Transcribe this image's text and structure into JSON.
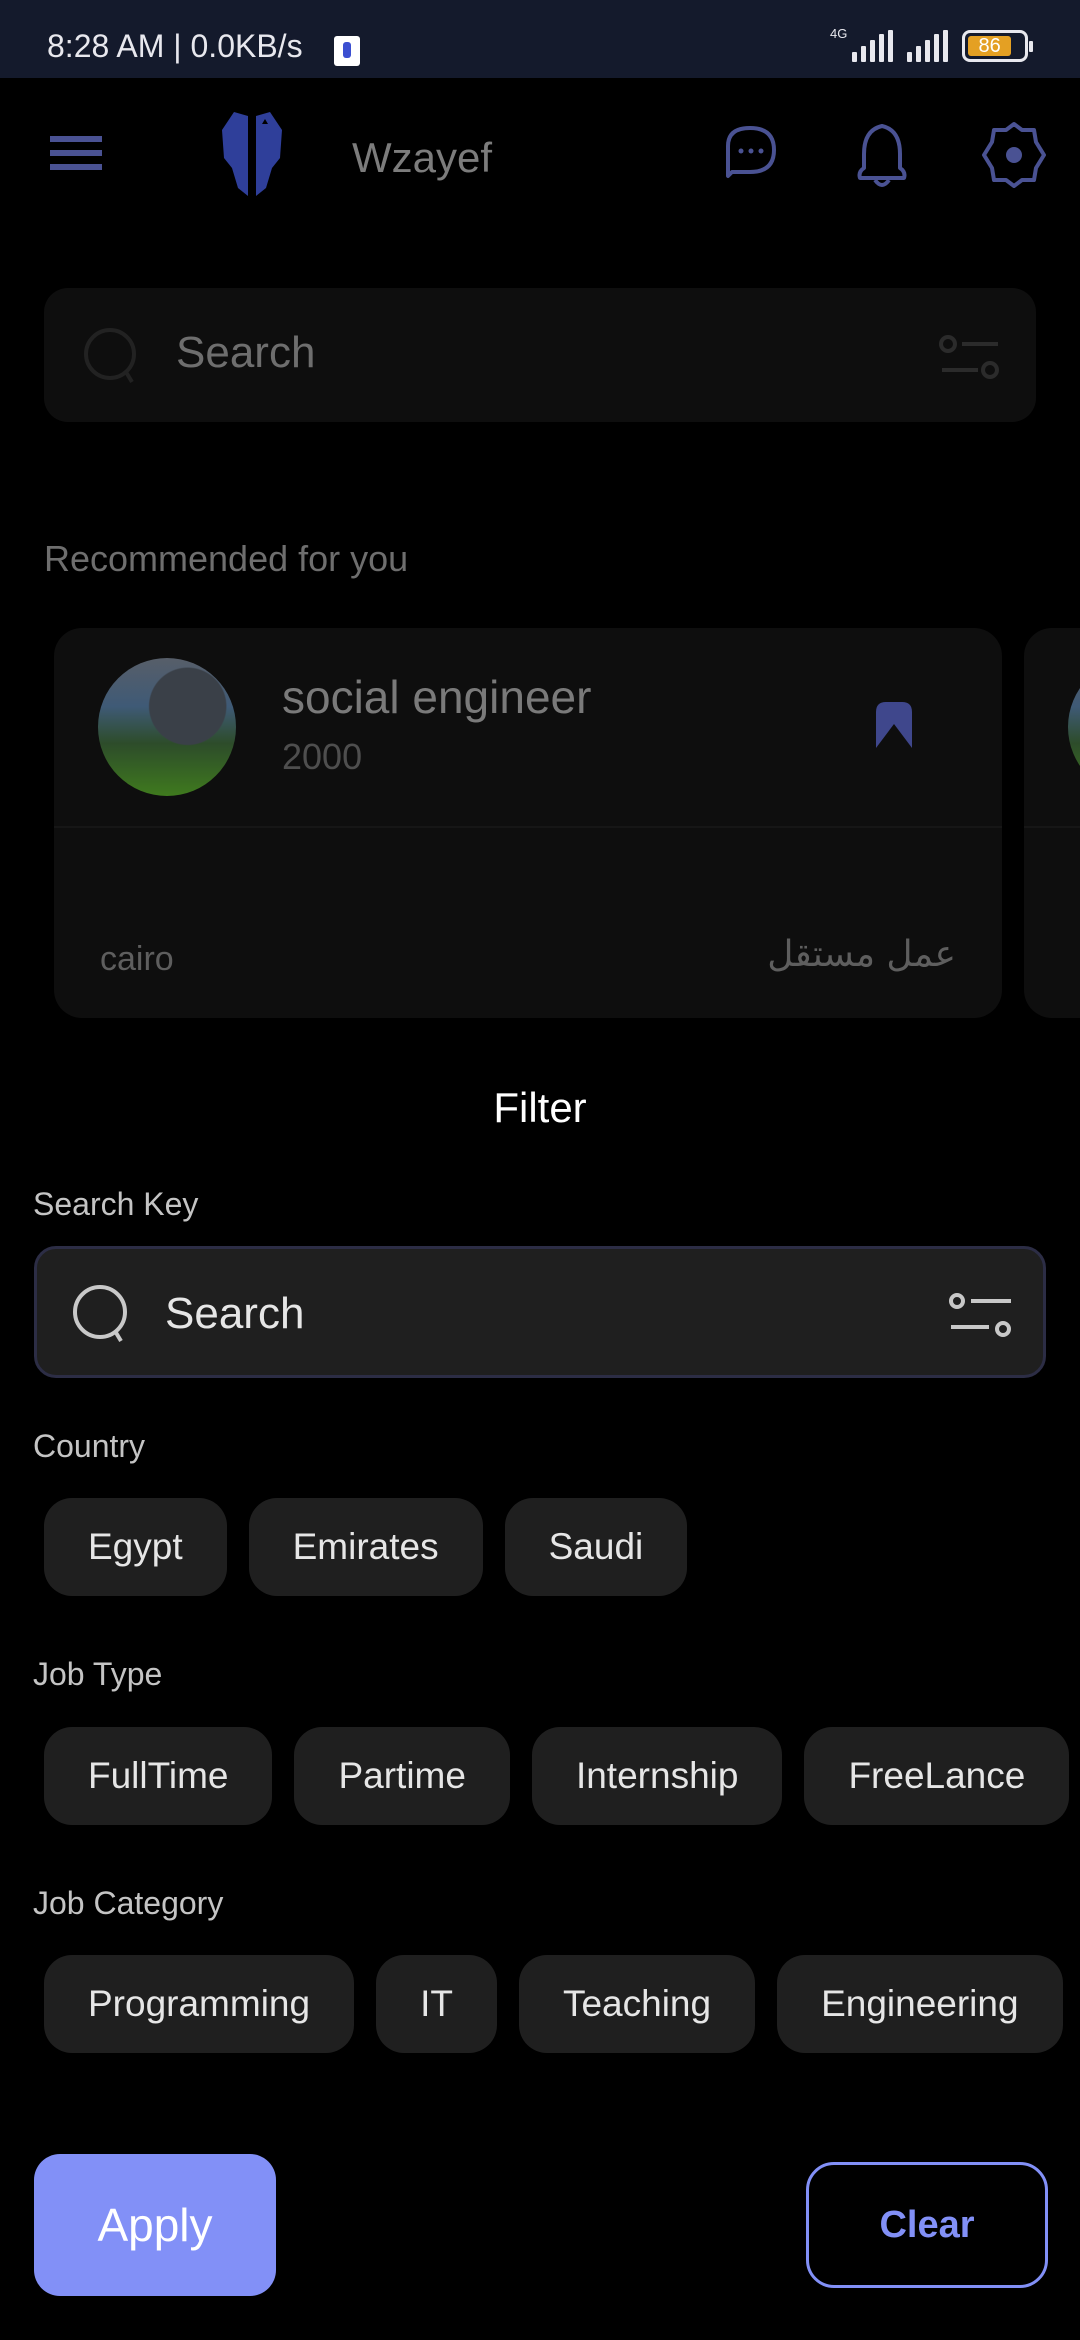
{
  "status_bar": {
    "time": "8:28 AM | 0.0KB/s",
    "network_label": "4G",
    "battery": "86"
  },
  "app_bar": {
    "title": "Wzayef",
    "icons": [
      "menu-icon",
      "logo-suit-icon",
      "chat-icon",
      "bell-icon",
      "gear-icon"
    ]
  },
  "background_search": {
    "placeholder": "Search"
  },
  "recommended": {
    "title": "Recommended for you",
    "cards": [
      {
        "title": "social engineer",
        "salary": "2000",
        "city": "cairo",
        "job_type": "عمل مستقل",
        "bookmarked": true
      }
    ]
  },
  "filter": {
    "title": "Filter",
    "search_key": {
      "label": "Search Key",
      "placeholder": "Search",
      "value": ""
    },
    "country": {
      "label": "Country",
      "options": [
        "Egypt",
        "Emirates",
        "Saudi"
      ]
    },
    "job_type": {
      "label": "Job Type",
      "options": [
        "FullTime",
        "Partime",
        "Internship",
        "FreeLance"
      ]
    },
    "job_category": {
      "label": "Job Category",
      "options": [
        "Programming",
        "IT",
        "Teaching",
        "Engineering"
      ]
    },
    "apply_label": "Apply",
    "clear_label": "Clear"
  },
  "colors": {
    "accent": "#8290f7",
    "icon_dim": "#4a5293",
    "status_bar_bg": "#141a2c",
    "chip_bg": "#1f1f1f",
    "battery": "#e4a023"
  }
}
